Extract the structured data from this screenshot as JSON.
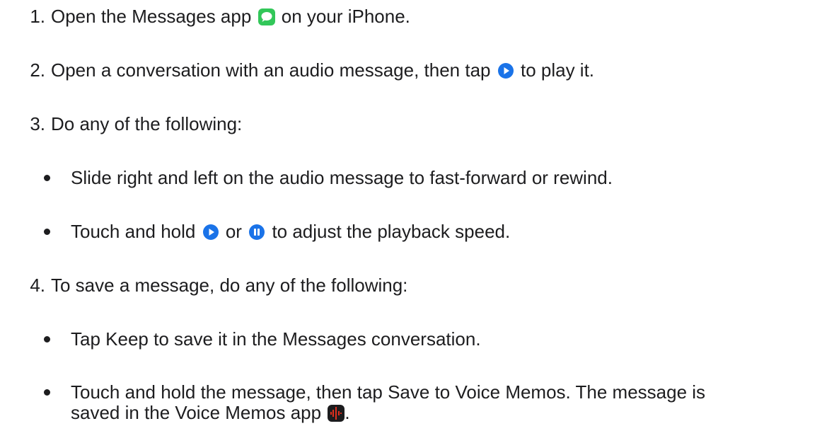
{
  "steps": [
    {
      "number": "1.",
      "before": "Open the Messages app",
      "icon": "messages-app-icon",
      "after": "on your iPhone."
    },
    {
      "number": "2.",
      "before": "Open a conversation with an audio message, then tap",
      "icon": "play-button-icon",
      "after": "to play it."
    },
    {
      "number": "3.",
      "text": "Do any of the following:",
      "bullets": [
        {
          "text": "Slide right and left on the audio message to fast-forward or rewind."
        },
        {
          "before": "Touch and hold",
          "icon1": "play-button-icon",
          "middle": "or",
          "icon2": "pause-button-icon",
          "after": "to adjust the playback speed."
        }
      ]
    },
    {
      "number": "4.",
      "text": "To save a message, do any of the following:",
      "bullets": [
        {
          "text": "Tap Keep to save it in the Messages conversation."
        },
        {
          "line1": "Touch and hold the message, then tap Save to Voice Memos. The message is",
          "line2_before": "saved in the Voice Memos app",
          "icon": "voice-memos-app-icon",
          "line2_after": "."
        }
      ]
    }
  ],
  "colors": {
    "text": "#1d1d1f",
    "messages_green": "#32c759",
    "playback_blue": "#1a73e8",
    "voice_memos_red": "#e0301e"
  }
}
